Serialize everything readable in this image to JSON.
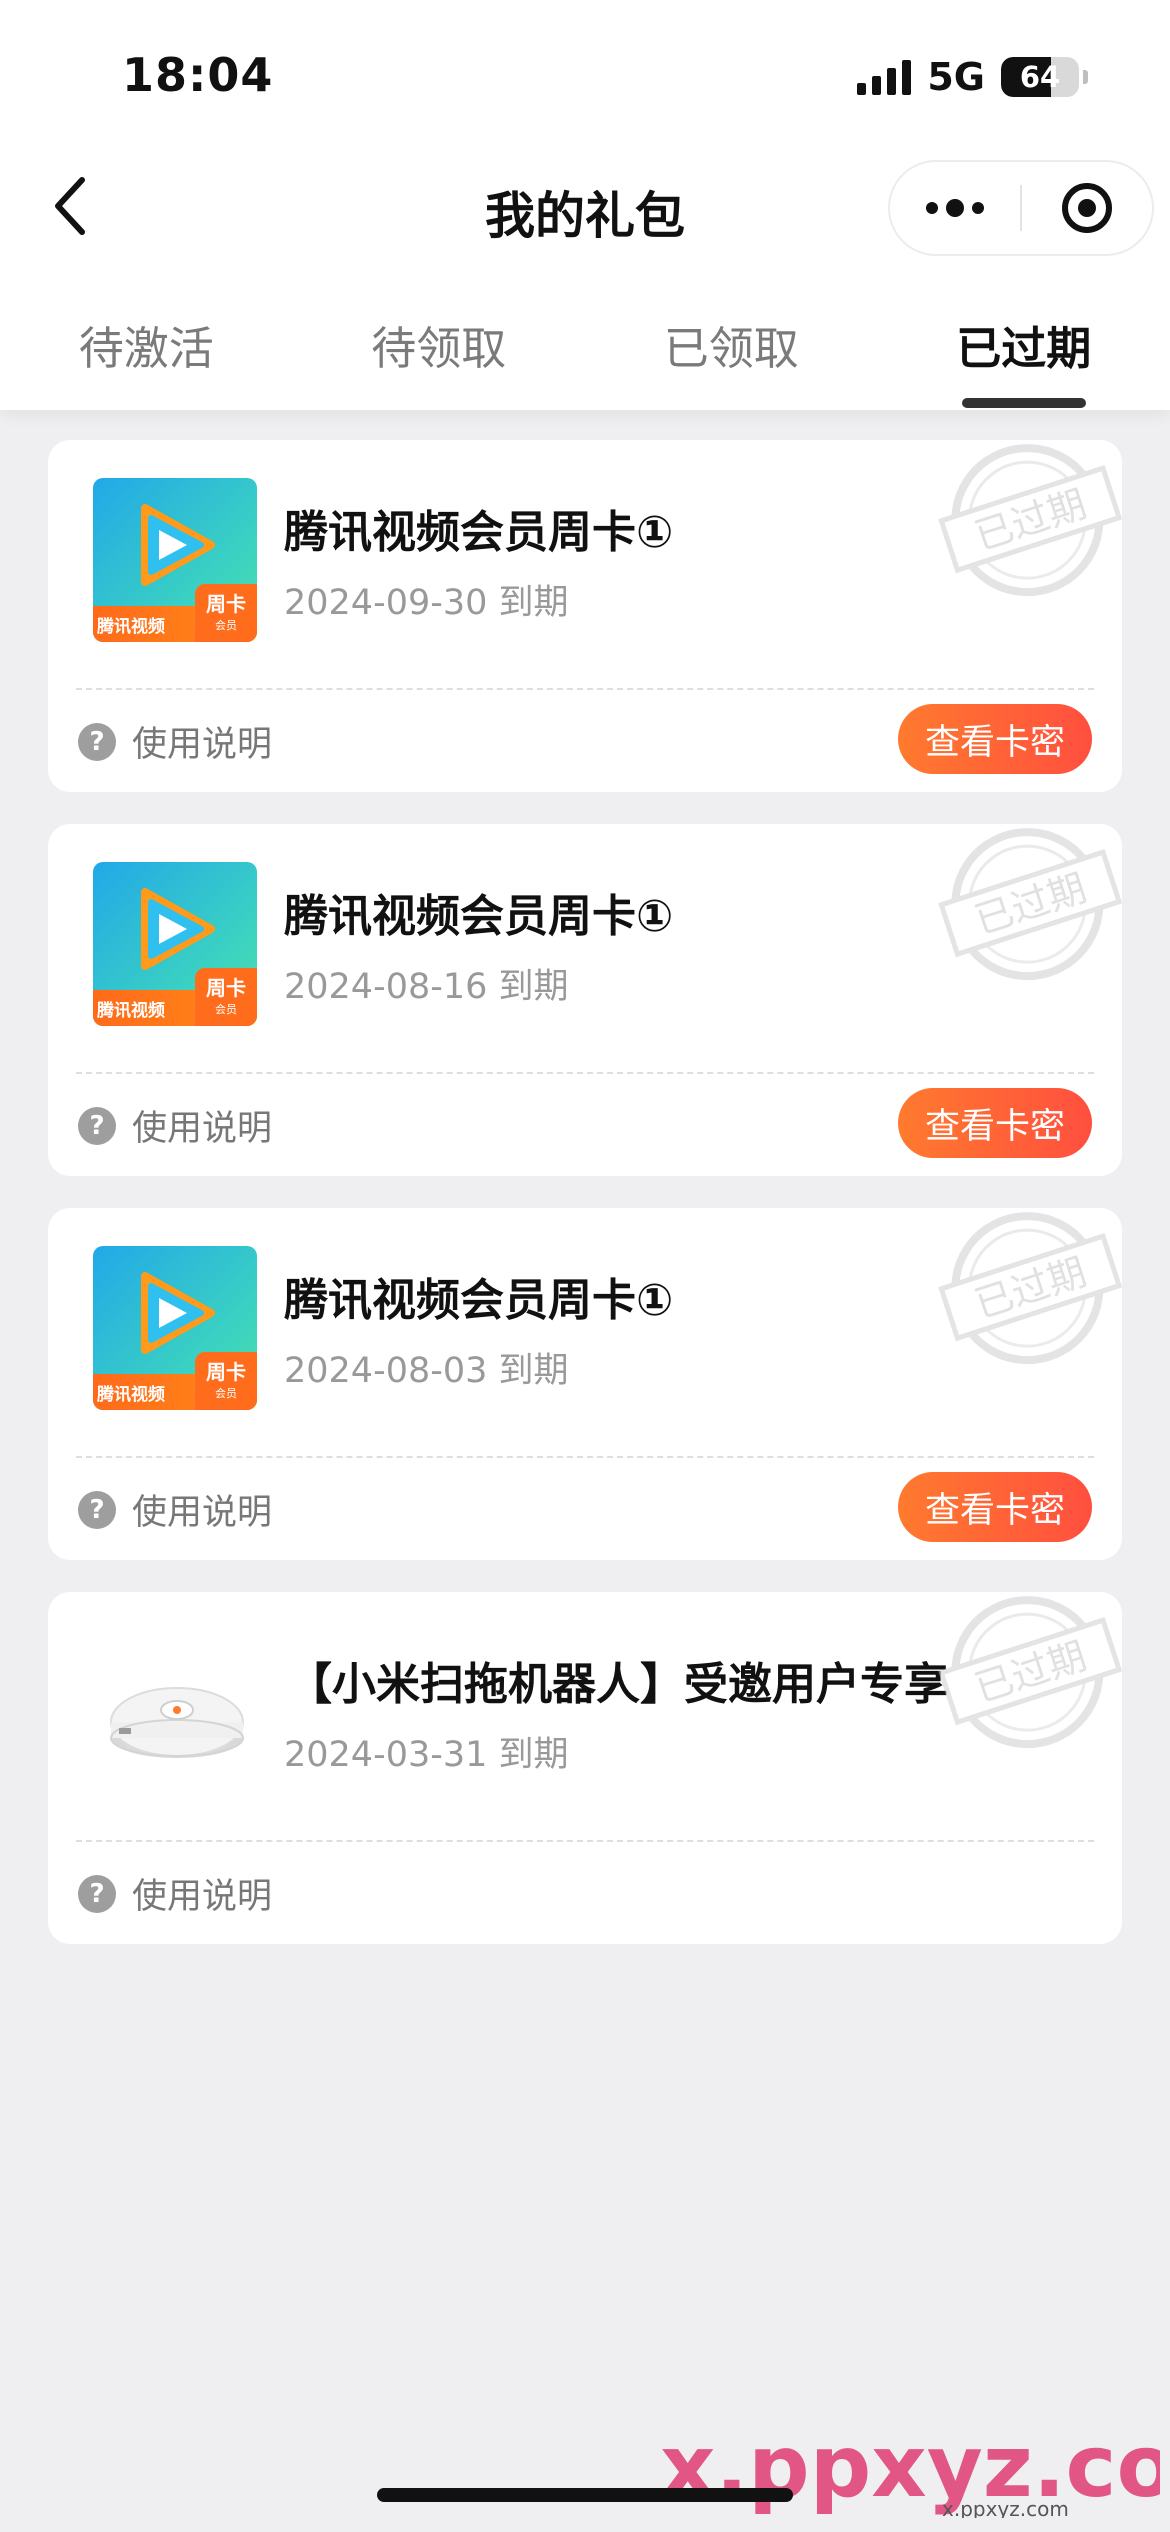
{
  "status_bar": {
    "time": "18:04",
    "network": "5G",
    "battery_level": "64",
    "battery_fraction": 0.64
  },
  "nav": {
    "title": "我的礼包",
    "back_icon": "chevron-left-icon",
    "more_icon": "more-dots-icon",
    "close_icon": "target-circle-icon"
  },
  "tabs": [
    {
      "label": "待激活",
      "active": false
    },
    {
      "label": "待领取",
      "active": false
    },
    {
      "label": "已领取",
      "active": false
    },
    {
      "label": "已过期",
      "active": true
    }
  ],
  "cards": [
    {
      "title": "腾讯视频会员周卡①",
      "date": "2024-09-30 到期",
      "help_label": "使用说明",
      "action_label": "查看卡密",
      "thumb": {
        "brand": "腾讯视频",
        "badge": "周卡",
        "badge_sub": "会员"
      },
      "stamp": "已过期"
    },
    {
      "title": "腾讯视频会员周卡①",
      "date": "2024-08-16 到期",
      "help_label": "使用说明",
      "action_label": "查看卡密",
      "thumb": {
        "brand": "腾讯视频",
        "badge": "周卡",
        "badge_sub": "会员"
      },
      "stamp": "已过期"
    },
    {
      "title": "腾讯视频会员周卡①",
      "date": "2024-08-03 到期",
      "help_label": "使用说明",
      "action_label": "查看卡密",
      "thumb": {
        "brand": "腾讯视频",
        "badge": "周卡",
        "badge_sub": "会员"
      },
      "stamp": "已过期"
    },
    {
      "title": "【小米扫拖机器人】受邀用户专享",
      "date": "2024-03-31 到期",
      "help_label": "使用说明",
      "stamp": "已过期"
    }
  ],
  "watermark": {
    "text": "x.ppxyz.com",
    "sub": "x.ppxyz.com"
  },
  "colors": {
    "accent_gradient_start": "#ff7a2e",
    "accent_gradient_end": "#ff4f3f",
    "background": "#efeff1"
  }
}
